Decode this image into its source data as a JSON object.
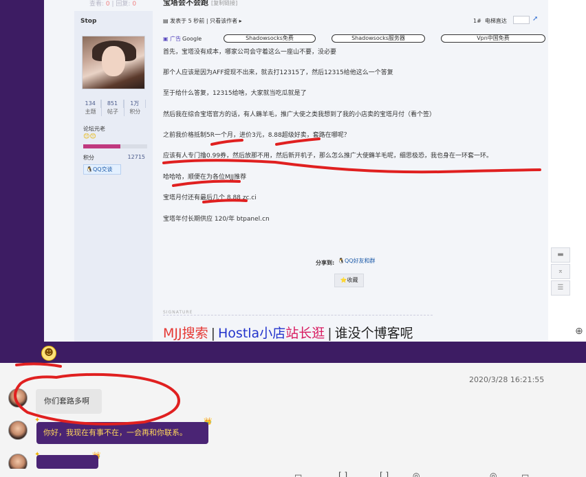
{
  "top_meta": {
    "views_label": "查看:",
    "views": "0",
    "replies_label": "回复:",
    "replies": "0"
  },
  "author": {
    "name": "Stop",
    "stats": [
      {
        "value": "134",
        "label": "主题"
      },
      {
        "value": "851",
        "label": "帖子"
      },
      {
        "value": "1万",
        "label": "积分"
      }
    ],
    "rank": "论坛元老",
    "emojis": "😊😊",
    "rank_progress": 0.58,
    "credits_label": "积分",
    "credits_value": "12715",
    "qq_button": "QQ交谈"
  },
  "post": {
    "title": "宝塔会不会跑",
    "copy_link": "[复制链接]",
    "posted": "发表于 5 秒前",
    "only_author": "只看该作者 ▸",
    "floor": "1#",
    "jump_label": "电梯直达",
    "ad_label": "广告",
    "ad_google": "Google",
    "ads": [
      "Shadowsocks免费",
      "Shadowsocks服务器",
      "Vpn中国免费"
    ],
    "paragraphs": [
      "首先，宝塔没有成本，哪家公司会守着这么一座山不要，没必要",
      "那个人应该是因为AFF提现不出来，就去打12315了，然后12315给他这么一个答复",
      "至于给什么答复，12315给啥，大家就当吃瓜就是了",
      "然后我在综合宝塔官方的话，有人薅羊毛，推广大使之类我想到了我的小店卖的宝塔月付（看个签）",
      "之前我价格抵制5R一个月，进价3元，8.88超级好卖，套路在哪呢？",
      "应该有人专门撸0.99券，然后放那不用，然后新开机子，那么怎么推广大使薅羊毛呢，细思极恐，我也身在一环套一环。",
      "哈哈哈，顺便在为各位MJJ推荐",
      "宝塔月付还有最后几个 8.88 zc.ci",
      "宝塔年付长期供应 120/年 btpanel.cn"
    ],
    "share_label": "分享到:",
    "share_target": "QQ好友和群",
    "favorite": "收藏",
    "signature_label": "SIGNATURE",
    "signature": {
      "part1": "MJJ搜索",
      "sep": "|",
      "part2": "Hostla小店",
      "part3": "站长逛",
      "part4": "谁没个博客呢"
    }
  },
  "chat": {
    "timestamp": "2020/3/28 16:21:55",
    "messages": [
      {
        "text": "你们套路多啊"
      },
      {
        "text": "你好，我现在有事不在，一会再和你联系。"
      },
      {
        "text": ""
      }
    ]
  },
  "colors": {
    "chat_purple": "#4a2474",
    "frame_purple": "#3d1c63",
    "annotation_red": "#e02020",
    "autoreply_text": "#ffd75a"
  }
}
